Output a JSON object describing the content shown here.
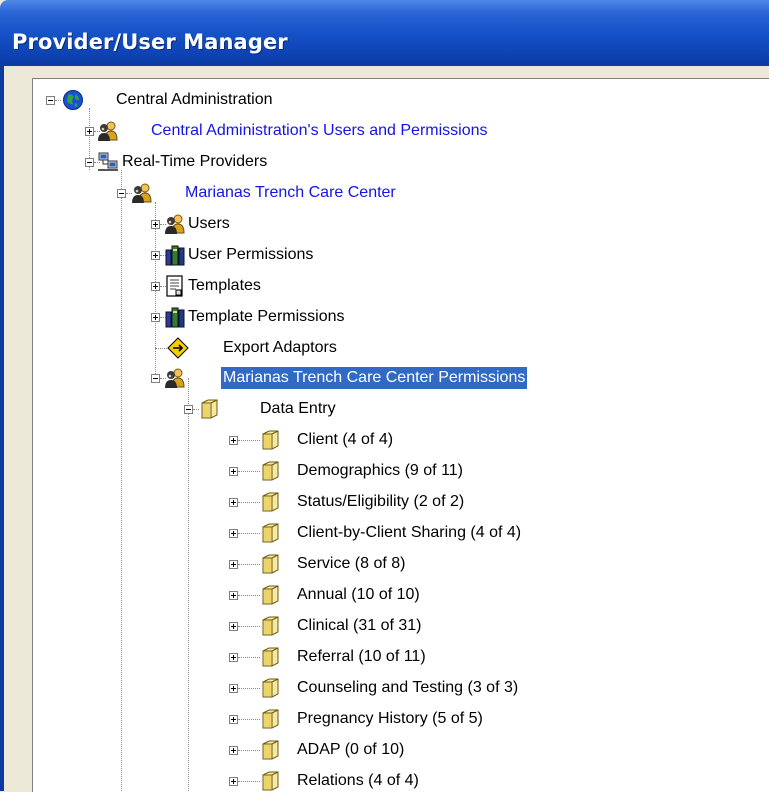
{
  "window": {
    "title": "Provider/User Manager"
  },
  "colors": {
    "titlebar": "#1652c8",
    "selection": "#316AC5",
    "link": "#1414e6",
    "frame": "#ECE9D8"
  },
  "tree": {
    "root": {
      "label": "Central Administration",
      "icon": "globe-icon"
    },
    "central_users": {
      "label": "Central Administration's Users and Permissions",
      "icon": "users-icon"
    },
    "realtime": {
      "label": "Real-Time Providers",
      "icon": "network-computers-icon"
    },
    "provider": {
      "label": "Marianas Trench Care Center",
      "icon": "users-icon"
    },
    "users": {
      "label": "Users",
      "icon": "users-icon"
    },
    "user_permissions": {
      "label": "User Permissions",
      "icon": "permissions-books-icon"
    },
    "templates": {
      "label": "Templates",
      "icon": "document-icon"
    },
    "template_permissions": {
      "label": "Template Permissions",
      "icon": "permissions-books-icon"
    },
    "export_adaptors": {
      "label": "Export Adaptors",
      "icon": "diamond-arrow-icon"
    },
    "provider_permissions": {
      "label": "Marianas Trench Care Center Permissions",
      "icon": "users-icon",
      "selected": true
    },
    "data_entry": {
      "label": "Data Entry",
      "icon": "folder-icon"
    },
    "children": [
      {
        "label": "Client (4 of 4)"
      },
      {
        "label": "Demographics (9 of 11)"
      },
      {
        "label": "Status/Eligibility (2 of 2)"
      },
      {
        "label": "Client-by-Client Sharing (4 of 4)"
      },
      {
        "label": "Service (8 of 8)"
      },
      {
        "label": "Annual (10 of 10)"
      },
      {
        "label": "Clinical (31 of 31)"
      },
      {
        "label": "Referral (10 of 11)"
      },
      {
        "label": "Counseling and Testing (3 of 3)"
      },
      {
        "label": "Pregnancy History (5 of 5)"
      },
      {
        "label": "ADAP (0 of 10)"
      },
      {
        "label": "Relations (4 of 4)"
      }
    ]
  }
}
